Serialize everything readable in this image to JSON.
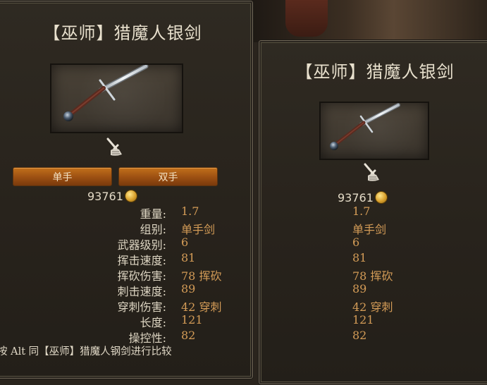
{
  "left_panel": {
    "title": "【巫师】猎魔人银剑",
    "mode_buttons": [
      {
        "label": "单手"
      },
      {
        "label": "双手"
      }
    ],
    "price": "93761",
    "stats": [
      {
        "label": "重量:",
        "value": "1.7"
      },
      {
        "label": "组别:",
        "value": "单手剑"
      },
      {
        "label": "武器级别:",
        "value": "6"
      },
      {
        "label": "挥击速度:",
        "value": "81"
      },
      {
        "label": "挥砍伤害:",
        "value": "78 挥砍"
      },
      {
        "label": "刺击速度:",
        "value": "89"
      },
      {
        "label": "穿刺伤害:",
        "value": "42 穿刺"
      },
      {
        "label": "长度:",
        "value": "121"
      },
      {
        "label": "操控性:",
        "value": "82"
      }
    ],
    "hint": "按 Alt 同【巫师】猎魔人钢剑进行比较"
  },
  "right_panel": {
    "title": "【巫师】猎魔人银剑",
    "price": "93761",
    "values": [
      "1.7",
      "单手剑",
      "6",
      "81",
      "78 挥砍",
      "89",
      "42 穿刺",
      "121",
      "82"
    ]
  },
  "icons": {
    "weapon_type": "one-handed-sword-type-icon",
    "currency": "gold-coin-icon",
    "item_image": "silver-sword-image"
  },
  "colors": {
    "panel_bg": "#2b261f",
    "title_text": "#e8e0cd",
    "stat_value": "#d49c57",
    "button_orange": "#b0601a"
  }
}
